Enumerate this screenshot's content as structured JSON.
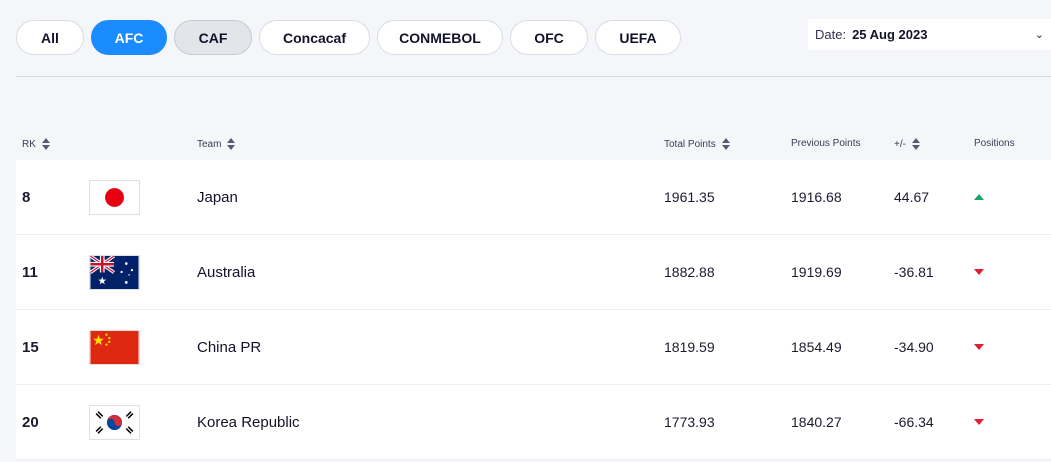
{
  "filters": [
    {
      "label": "All",
      "state": "default"
    },
    {
      "label": "AFC",
      "state": "active"
    },
    {
      "label": "CAF",
      "state": "hover"
    },
    {
      "label": "Concacaf",
      "state": "default"
    },
    {
      "label": "CONMEBOL",
      "state": "default"
    },
    {
      "label": "OFC",
      "state": "default"
    },
    {
      "label": "UEFA",
      "state": "default"
    }
  ],
  "date": {
    "label": "Date:",
    "value": "25 Aug 2023"
  },
  "columns": {
    "rank": "RK",
    "team": "Team",
    "total_points": "Total Points",
    "previous_points": "Previous Points",
    "diff": "+/-",
    "positions": "Positions"
  },
  "rows": [
    {
      "rank": "8",
      "team": "Japan",
      "flag": "japan-flag",
      "total": "1961.35",
      "previous": "1916.68",
      "diff": "44.67",
      "movement": "up"
    },
    {
      "rank": "11",
      "team": "Australia",
      "flag": "australia-flag",
      "total": "1882.88",
      "previous": "1919.69",
      "diff": "-36.81",
      "movement": "down"
    },
    {
      "rank": "15",
      "team": "China PR",
      "flag": "china-flag",
      "total": "1819.59",
      "previous": "1854.49",
      "diff": "-34.90",
      "movement": "down"
    },
    {
      "rank": "20",
      "team": "Korea Republic",
      "flag": "korea-flag",
      "total": "1773.93",
      "previous": "1840.27",
      "diff": "-66.34",
      "movement": "down"
    }
  ],
  "colors": {
    "accent": "#1a8cff",
    "up": "#1aa563",
    "down": "#e02030"
  }
}
